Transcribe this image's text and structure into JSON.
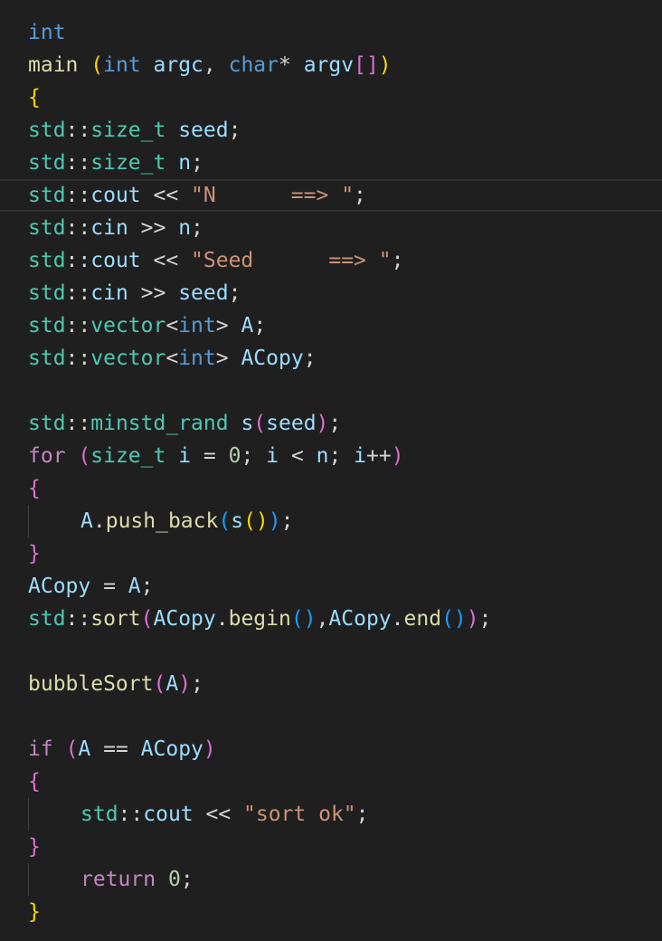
{
  "editor": {
    "lines": [
      [
        {
          "t": "int",
          "c": "kw"
        }
      ],
      [
        {
          "t": "main",
          "c": "fn"
        },
        {
          "t": " ",
          "c": "op"
        },
        {
          "t": "(",
          "c": "b1"
        },
        {
          "t": "int",
          "c": "kw"
        },
        {
          "t": " ",
          "c": "op"
        },
        {
          "t": "argc",
          "c": "var"
        },
        {
          "t": ", ",
          "c": "op"
        },
        {
          "t": "char",
          "c": "kw"
        },
        {
          "t": "* ",
          "c": "op"
        },
        {
          "t": "argv",
          "c": "var"
        },
        {
          "t": "[]",
          "c": "b2"
        },
        {
          "t": ")",
          "c": "b1"
        }
      ],
      [
        {
          "t": "{",
          "c": "b1"
        }
      ],
      [
        {
          "t": "std",
          "c": "ns"
        },
        {
          "t": "::",
          "c": "op"
        },
        {
          "t": "size_t",
          "c": "ns"
        },
        {
          "t": " ",
          "c": "op"
        },
        {
          "t": "seed",
          "c": "var"
        },
        {
          "t": ";",
          "c": "op"
        }
      ],
      [
        {
          "t": "std",
          "c": "ns"
        },
        {
          "t": "::",
          "c": "op"
        },
        {
          "t": "size_t",
          "c": "ns"
        },
        {
          "t": " ",
          "c": "op"
        },
        {
          "t": "n",
          "c": "var"
        },
        {
          "t": ";",
          "c": "op"
        }
      ],
      [
        {
          "t": "std",
          "c": "ns"
        },
        {
          "t": "::",
          "c": "op"
        },
        {
          "t": "cout",
          "c": "var"
        },
        {
          "t": " << ",
          "c": "op"
        },
        {
          "t": "\"N      ==> \"",
          "c": "str"
        },
        {
          "t": ";",
          "c": "op"
        }
      ],
      [
        {
          "t": "std",
          "c": "ns"
        },
        {
          "t": "::",
          "c": "op"
        },
        {
          "t": "cin",
          "c": "var"
        },
        {
          "t": " >> ",
          "c": "op"
        },
        {
          "t": "n",
          "c": "var"
        },
        {
          "t": ";",
          "c": "op"
        }
      ],
      [
        {
          "t": "std",
          "c": "ns"
        },
        {
          "t": "::",
          "c": "op"
        },
        {
          "t": "cout",
          "c": "var"
        },
        {
          "t": " << ",
          "c": "op"
        },
        {
          "t": "\"Seed      ==> \"",
          "c": "str"
        },
        {
          "t": ";",
          "c": "op"
        }
      ],
      [
        {
          "t": "std",
          "c": "ns"
        },
        {
          "t": "::",
          "c": "op"
        },
        {
          "t": "cin",
          "c": "var"
        },
        {
          "t": " >> ",
          "c": "op"
        },
        {
          "t": "seed",
          "c": "var"
        },
        {
          "t": ";",
          "c": "op"
        }
      ],
      [
        {
          "t": "std",
          "c": "ns"
        },
        {
          "t": "::",
          "c": "op"
        },
        {
          "t": "vector",
          "c": "ns"
        },
        {
          "t": "<",
          "c": "op"
        },
        {
          "t": "int",
          "c": "kw"
        },
        {
          "t": "> ",
          "c": "op"
        },
        {
          "t": "A",
          "c": "var"
        },
        {
          "t": ";",
          "c": "op"
        }
      ],
      [
        {
          "t": "std",
          "c": "ns"
        },
        {
          "t": "::",
          "c": "op"
        },
        {
          "t": "vector",
          "c": "ns"
        },
        {
          "t": "<",
          "c": "op"
        },
        {
          "t": "int",
          "c": "kw"
        },
        {
          "t": "> ",
          "c": "op"
        },
        {
          "t": "ACopy",
          "c": "var"
        },
        {
          "t": ";",
          "c": "op"
        }
      ],
      [],
      [
        {
          "t": "std",
          "c": "ns"
        },
        {
          "t": "::",
          "c": "op"
        },
        {
          "t": "minstd_rand",
          "c": "ns"
        },
        {
          "t": " ",
          "c": "op"
        },
        {
          "t": "s",
          "c": "var"
        },
        {
          "t": "(",
          "c": "b2"
        },
        {
          "t": "seed",
          "c": "var"
        },
        {
          "t": ")",
          "c": "b2"
        },
        {
          "t": ";",
          "c": "op"
        }
      ],
      [
        {
          "t": "for",
          "c": "ctrl"
        },
        {
          "t": " ",
          "c": "op"
        },
        {
          "t": "(",
          "c": "b2"
        },
        {
          "t": "size_t",
          "c": "ns"
        },
        {
          "t": " ",
          "c": "op"
        },
        {
          "t": "i",
          "c": "var"
        },
        {
          "t": " = ",
          "c": "op"
        },
        {
          "t": "0",
          "c": "num"
        },
        {
          "t": "; ",
          "c": "op"
        },
        {
          "t": "i",
          "c": "var"
        },
        {
          "t": " < ",
          "c": "op"
        },
        {
          "t": "n",
          "c": "var"
        },
        {
          "t": "; ",
          "c": "op"
        },
        {
          "t": "i",
          "c": "var"
        },
        {
          "t": "++",
          "c": "op"
        },
        {
          "t": ")",
          "c": "b2"
        }
      ],
      [
        {
          "t": "{",
          "c": "b2"
        }
      ],
      [
        {
          "t": "A",
          "c": "var"
        },
        {
          "t": ".",
          "c": "op"
        },
        {
          "t": "push_back",
          "c": "fn"
        },
        {
          "t": "(",
          "c": "b3"
        },
        {
          "t": "s",
          "c": "var"
        },
        {
          "t": "()",
          "c": "b1"
        },
        {
          "t": ")",
          "c": "b3"
        },
        {
          "t": ";",
          "c": "op"
        }
      ],
      [
        {
          "t": "}",
          "c": "b2"
        }
      ],
      [
        {
          "t": "ACopy",
          "c": "var"
        },
        {
          "t": " = ",
          "c": "op"
        },
        {
          "t": "A",
          "c": "var"
        },
        {
          "t": ";",
          "c": "op"
        }
      ],
      [
        {
          "t": "std",
          "c": "ns"
        },
        {
          "t": "::",
          "c": "op"
        },
        {
          "t": "sort",
          "c": "fn"
        },
        {
          "t": "(",
          "c": "b2"
        },
        {
          "t": "ACopy",
          "c": "var"
        },
        {
          "t": ".",
          "c": "op"
        },
        {
          "t": "begin",
          "c": "fn"
        },
        {
          "t": "()",
          "c": "b3"
        },
        {
          "t": ",",
          "c": "op"
        },
        {
          "t": "ACopy",
          "c": "var"
        },
        {
          "t": ".",
          "c": "op"
        },
        {
          "t": "end",
          "c": "fn"
        },
        {
          "t": "()",
          "c": "b3"
        },
        {
          "t": ")",
          "c": "b2"
        },
        {
          "t": ";",
          "c": "op"
        }
      ],
      [],
      [
        {
          "t": "bubbleSort",
          "c": "fn"
        },
        {
          "t": "(",
          "c": "b2"
        },
        {
          "t": "A",
          "c": "var"
        },
        {
          "t": ")",
          "c": "b2"
        },
        {
          "t": ";",
          "c": "op"
        }
      ],
      [],
      [
        {
          "t": "if",
          "c": "ctrl"
        },
        {
          "t": " ",
          "c": "op"
        },
        {
          "t": "(",
          "c": "b2"
        },
        {
          "t": "A",
          "c": "var"
        },
        {
          "t": " == ",
          "c": "op"
        },
        {
          "t": "ACopy",
          "c": "var"
        },
        {
          "t": ")",
          "c": "b2"
        }
      ],
      [
        {
          "t": "{",
          "c": "b2"
        }
      ],
      [
        {
          "t": "std",
          "c": "ns"
        },
        {
          "t": "::",
          "c": "op"
        },
        {
          "t": "cout",
          "c": "var"
        },
        {
          "t": " << ",
          "c": "op"
        },
        {
          "t": "\"sort ok\"",
          "c": "str"
        },
        {
          "t": ";",
          "c": "op"
        }
      ],
      [
        {
          "t": "}",
          "c": "b2"
        }
      ],
      [
        {
          "t": "return",
          "c": "ctrl"
        },
        {
          "t": " ",
          "c": "op"
        },
        {
          "t": "0",
          "c": "num"
        },
        {
          "t": ";",
          "c": "op"
        }
      ],
      [
        {
          "t": "}",
          "c": "b1"
        }
      ]
    ],
    "indented_lines": [
      15,
      24,
      26
    ],
    "current_line": 5,
    "colors": {
      "background": "#1f1f1f",
      "keyword": "#569cd6",
      "control": "#c586c0",
      "function": "#dcdcaa",
      "variable": "#9cdcfe",
      "type": "#4ec9b0",
      "string": "#ce9178",
      "number": "#b5cea8",
      "bracket_gold": "#ffd700",
      "bracket_orchid": "#da70d6",
      "bracket_blue": "#179fff"
    }
  }
}
